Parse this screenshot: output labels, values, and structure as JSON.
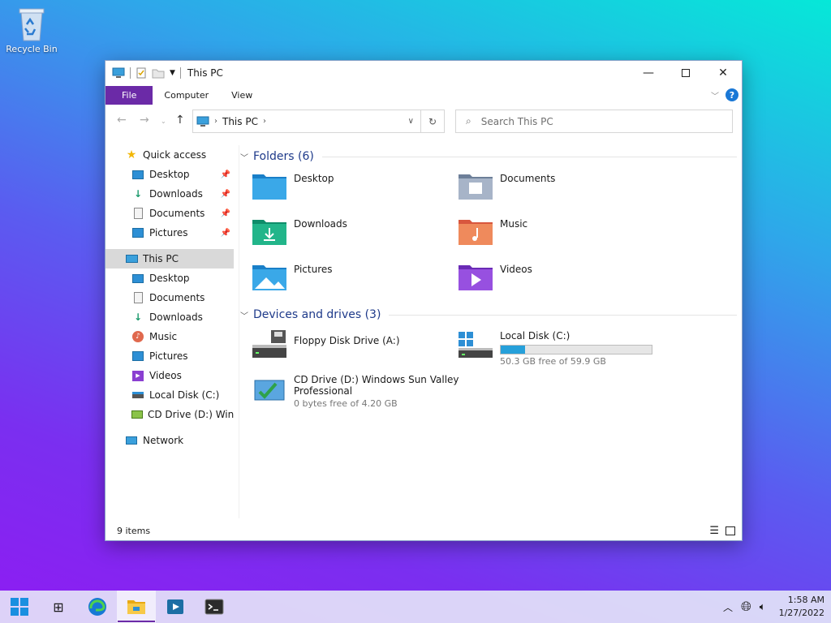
{
  "desktop": {
    "recycle_bin_label": "Recycle Bin"
  },
  "window": {
    "title": "This PC",
    "ribbon_tabs": [
      "File",
      "Computer",
      "View"
    ],
    "help_label": "?",
    "address": {
      "location": "This PC"
    },
    "search": {
      "placeholder": "Search This PC"
    },
    "nav": {
      "quick_access": "Quick access",
      "quick_items": [
        "Desktop",
        "Downloads",
        "Documents",
        "Pictures"
      ],
      "this_pc": "This PC",
      "pc_items": [
        "Desktop",
        "Documents",
        "Downloads",
        "Music",
        "Pictures",
        "Videos",
        "Local Disk (C:)",
        "CD Drive (D:) Windows Sun Valley Professional"
      ],
      "network": "Network"
    },
    "folders_header": "Folders (6)",
    "folders": [
      "Desktop",
      "Documents",
      "Downloads",
      "Music",
      "Pictures",
      "Videos"
    ],
    "devices_header": "Devices and drives (3)",
    "drives": {
      "floppy": {
        "name": "Floppy Disk Drive (A:)"
      },
      "local": {
        "name": "Local Disk (C:)",
        "free": "50.3 GB free of 59.9 GB",
        "used_fraction": 0.16
      },
      "cd": {
        "name_line1": "CD Drive (D:) Windows Sun Valley",
        "name_line2": "Professional",
        "free": "0 bytes free of 4.20 GB"
      }
    },
    "status": "9 items"
  },
  "taskbar": {
    "time": "1:58 AM",
    "date": "1/27/2022"
  },
  "colors": {
    "accent": "#6b2aa7",
    "drive_bar": "#26a0da",
    "group_heading": "#1e3a8a"
  }
}
